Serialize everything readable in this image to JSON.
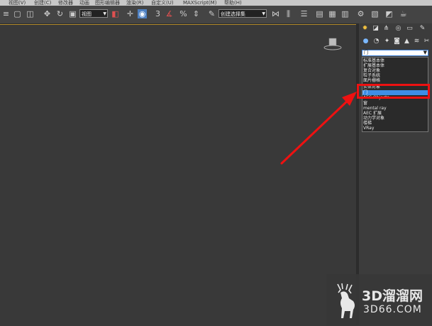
{
  "menu": [
    "视图(V)",
    "创建(C)",
    "修改器",
    "动画",
    "图形编辑器",
    "渲染(R)",
    "自定义(U)",
    "MAXScript(M)",
    "帮助(H)"
  ],
  "toolbar": {
    "view_dropdown": "视图",
    "snap_label": "3",
    "percent_label": "%",
    "selection_set": "创建选择集"
  },
  "panel": {
    "category_value": "门",
    "category_options": [
      "标准基本体",
      "扩展基本体",
      "复合对象",
      "粒子系统",
      "面片栅格",
      "实体对象",
      "门",
      "AEC Objects",
      "窗",
      "mental ray",
      "AEC 扩展",
      "动力学对象",
      "楼梯",
      "VRay"
    ],
    "selected_index": 6
  },
  "watermark": {
    "title": "3D溜溜网",
    "url": "3D66.COM"
  },
  "colors": {
    "highlight": "#e11111",
    "selection": "#3d8ee6",
    "viewport": "#393939"
  }
}
